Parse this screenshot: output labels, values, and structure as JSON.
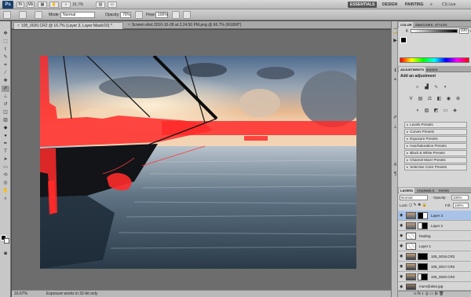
{
  "appbar": {
    "logo": "Ps",
    "zoom": "16.7%",
    "workspaces": [
      "ESSENTIALS",
      "DESIGN",
      "PAINTING",
      "»"
    ],
    "cs_live": "CS Live"
  },
  "options": {
    "mode_label": "Mode:",
    "mode_value": "Normal",
    "opacity_label": "Opacity:",
    "opacity_value": "70%",
    "flow_label": "Flow:",
    "flow_value": "100%"
  },
  "doc_tabs": [
    {
      "label": "105_0020.CR2 @ 16.7% (Layer 3, Layer Mask/16) *"
    },
    {
      "label": "Screen shot 2010-10-28 at 2.24.50 PM.png @ 66.7% (RGB/8*)"
    }
  ],
  "status": {
    "zoom": "16.67%",
    "message": "Exposure works in 32-bit only"
  },
  "color_panel": {
    "tabs": [
      "COLOR",
      "SWATCHES",
      "STYLES"
    ],
    "k_label": "K",
    "k_value": "100",
    "k_unit": "%"
  },
  "adjustments_panel": {
    "tabs": [
      "ADJUSTMENTS",
      "MASKS"
    ],
    "title": "Add an adjustment",
    "presets": [
      "Levels Presets",
      "Curves Presets",
      "Exposure Presets",
      "Hue/Saturation Presets",
      "Black & White Presets",
      "Channel Mixer Presets",
      "Selective Color Presets"
    ]
  },
  "layers_panel": {
    "tabs": [
      "LAYERS",
      "CHANNELS",
      "PATHS"
    ],
    "blend_mode": "Normal",
    "opacity_label": "Opacity:",
    "opacity_value": "100%",
    "lock_label": "Lock:",
    "fill_label": "Fill:",
    "fill_value": "100%",
    "layers": [
      {
        "name": "Layer 3",
        "selected": true,
        "mask": true
      },
      {
        "name": "Layer 2",
        "selected": false,
        "mask": true
      },
      {
        "name": "healing",
        "selected": false,
        "mask": false
      },
      {
        "name": "Layer 1",
        "selected": false,
        "mask": false
      },
      {
        "name": "105_0016.CR2",
        "selected": false,
        "mask": true
      },
      {
        "name": "105_0017.CR2",
        "selected": false,
        "mask": true
      },
      {
        "name": "105_0020.CR2",
        "selected": false,
        "mask": true
      },
      {
        "name": "mum@alan.jpg",
        "selected": false,
        "mask": false
      }
    ]
  },
  "colors": {
    "mask_overlay": "#ff2a2a",
    "selected_layer": "#a9c3e8",
    "panel_bg": "#d6d6d6"
  }
}
